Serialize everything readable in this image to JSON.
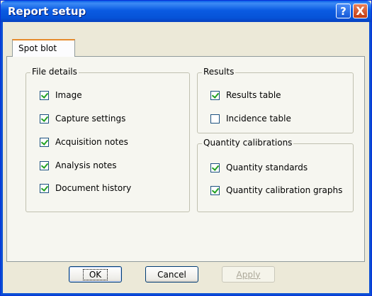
{
  "window": {
    "title": "Report setup"
  },
  "titlebar": {
    "help_label": "?",
    "close_label": "X"
  },
  "tabs": [
    {
      "label": "Spot blot",
      "selected": true
    }
  ],
  "file_details": {
    "legend": "File details",
    "items": [
      {
        "label": "Image",
        "checked": true
      },
      {
        "label": "Capture settings",
        "checked": true
      },
      {
        "label": "Acquisition notes",
        "checked": true
      },
      {
        "label": "Analysis notes",
        "checked": true
      },
      {
        "label": "Document history",
        "checked": true
      }
    ]
  },
  "results": {
    "legend": "Results",
    "items": [
      {
        "label": "Results table",
        "checked": true
      },
      {
        "label": "Incidence table",
        "checked": false
      }
    ]
  },
  "quantity_calibrations": {
    "legend": "Quantity calibrations",
    "items": [
      {
        "label": "Quantity standards",
        "checked": true
      },
      {
        "label": "Quantity calibration graphs",
        "checked": true
      }
    ]
  },
  "buttons": {
    "ok": "OK",
    "cancel": "Cancel",
    "apply": "Apply"
  },
  "colors": {
    "titlebar": "#0a5be2",
    "dialog_bg": "#ece9d8",
    "check": "#21a121"
  }
}
